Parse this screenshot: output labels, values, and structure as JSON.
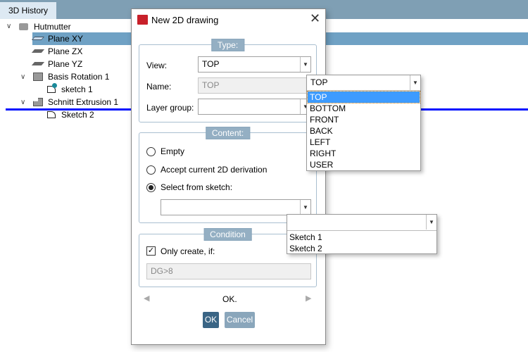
{
  "tab": {
    "label": "3D History"
  },
  "tree": [
    {
      "label": "Hutmutter",
      "icon": "nut-icon",
      "expanded": true
    },
    {
      "label": "Plane XY",
      "icon": "plane-icon",
      "selected": true
    },
    {
      "label": "Plane ZX",
      "icon": "plane-icon"
    },
    {
      "label": "Plane YZ",
      "icon": "plane-icon"
    },
    {
      "label": "Basis Rotation 1",
      "icon": "solid-icon",
      "expanded": true
    },
    {
      "label": "sketch 1",
      "icon": "sketch-warning-icon"
    },
    {
      "label": "Schnitt Extrusion 1",
      "icon": "extrusion-icon",
      "expanded": true
    },
    {
      "label": "Sketch 2",
      "icon": "sketch-icon"
    }
  ],
  "dialog": {
    "title": "New 2D drawing",
    "type_legend": "Type:",
    "view_label": "View:",
    "view_value": "TOP",
    "name_label": "Name:",
    "name_value": "TOP",
    "layer_label": "Layer group:",
    "layer_value": "",
    "content_legend": "Content:",
    "radio_empty": "Empty",
    "radio_accept": "Accept current 2D derivation",
    "radio_select": "Select from sketch:",
    "sketch_value": "",
    "condition_legend": "Condition",
    "only_create": "Only create, if:",
    "only_create_checked": true,
    "condition_value": "DG>8",
    "status": "OK.",
    "ok": "OK",
    "cancel": "Cancel"
  },
  "view_dropdown": {
    "value": "TOP",
    "options": [
      "TOP",
      "BOTTOM",
      "FRONT",
      "BACK",
      "LEFT",
      "RIGHT",
      "USER"
    ],
    "highlighted": "TOP"
  },
  "sketch_dropdown": {
    "value": "",
    "options": [
      "Sketch 1",
      "Sketch 2"
    ]
  },
  "colors": {
    "accent": "#94afc3",
    "selection": "#6fa1c4",
    "ok_button": "#3a6585",
    "highlight": "#3d9bff",
    "drop_line": "#0010ff"
  }
}
